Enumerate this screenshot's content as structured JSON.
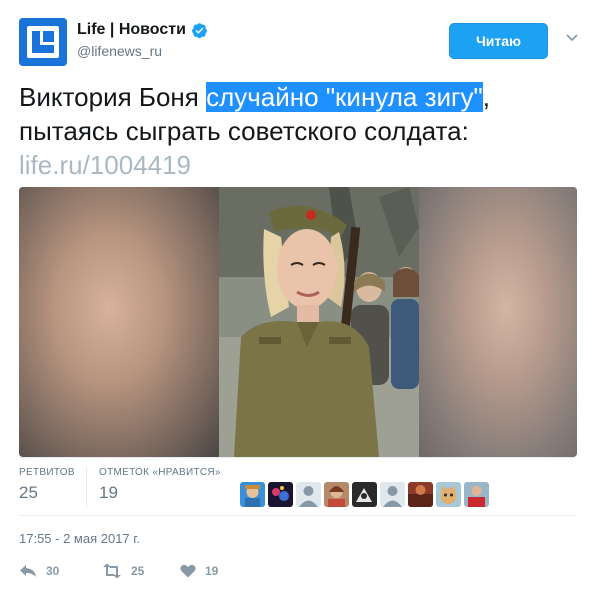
{
  "account": {
    "name": "Life | Новости",
    "handle": "@lifenews_ru",
    "verified": true
  },
  "follow_button": {
    "label": "Читаю"
  },
  "tweet": {
    "text_before": "Виктория Боня ",
    "text_highlight": "случайно \"кинула зигу\"",
    "text_after": ", пытаясь сыграть советского солдата: ",
    "link": "life.ru/1004419"
  },
  "stats": {
    "retweets_label": "РЕТВИТОВ",
    "retweets": "25",
    "likes_label": "ОТМЕТОК «НРАВИТСЯ»",
    "likes": "19"
  },
  "timestamp": "17:55 - 2 мая 2017 г.",
  "actions": {
    "reply_count": "30",
    "retweet_count": "25",
    "like_count": "19"
  },
  "colors": {
    "accent": "#1da1f2",
    "highlight": "#1e90ff",
    "muted": "#657786"
  }
}
